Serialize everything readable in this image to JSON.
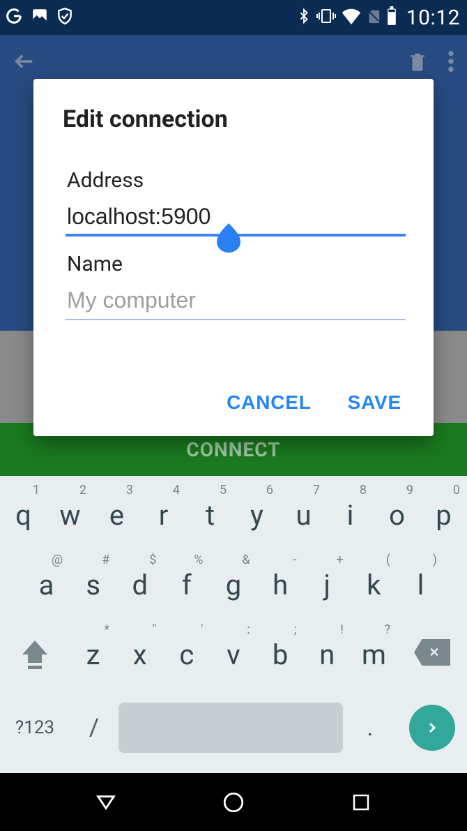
{
  "status": {
    "time": "10:12"
  },
  "background": {
    "connect_label": "CONNECT"
  },
  "dialog": {
    "title": "Edit connection",
    "address_label": "Address",
    "address_value": "localhost:5900",
    "name_label": "Name",
    "name_value": "",
    "name_placeholder": "My computer",
    "cancel_label": "CANCEL",
    "save_label": "SAVE"
  },
  "keyboard": {
    "row1": [
      {
        "main": "q",
        "hint": "1"
      },
      {
        "main": "w",
        "hint": "2"
      },
      {
        "main": "e",
        "hint": "3"
      },
      {
        "main": "r",
        "hint": "4"
      },
      {
        "main": "t",
        "hint": "5"
      },
      {
        "main": "y",
        "hint": "6"
      },
      {
        "main": "u",
        "hint": "7"
      },
      {
        "main": "i",
        "hint": "8"
      },
      {
        "main": "o",
        "hint": "9"
      },
      {
        "main": "p",
        "hint": "0"
      }
    ],
    "row2": [
      {
        "main": "a",
        "hint": "@"
      },
      {
        "main": "s",
        "hint": "#"
      },
      {
        "main": "d",
        "hint": "$"
      },
      {
        "main": "f",
        "hint": "%"
      },
      {
        "main": "g",
        "hint": "&"
      },
      {
        "main": "h",
        "hint": "-"
      },
      {
        "main": "j",
        "hint": "+"
      },
      {
        "main": "k",
        "hint": "("
      },
      {
        "main": "l",
        "hint": ")"
      }
    ],
    "row3": [
      {
        "main": "z",
        "hint": "*"
      },
      {
        "main": "x",
        "hint": "\""
      },
      {
        "main": "c",
        "hint": "'"
      },
      {
        "main": "v",
        "hint": ":"
      },
      {
        "main": "b",
        "hint": ";"
      },
      {
        "main": "n",
        "hint": "!"
      },
      {
        "main": "m",
        "hint": "?"
      }
    ],
    "sym": "?123",
    "slash": "/",
    "dot": "."
  }
}
